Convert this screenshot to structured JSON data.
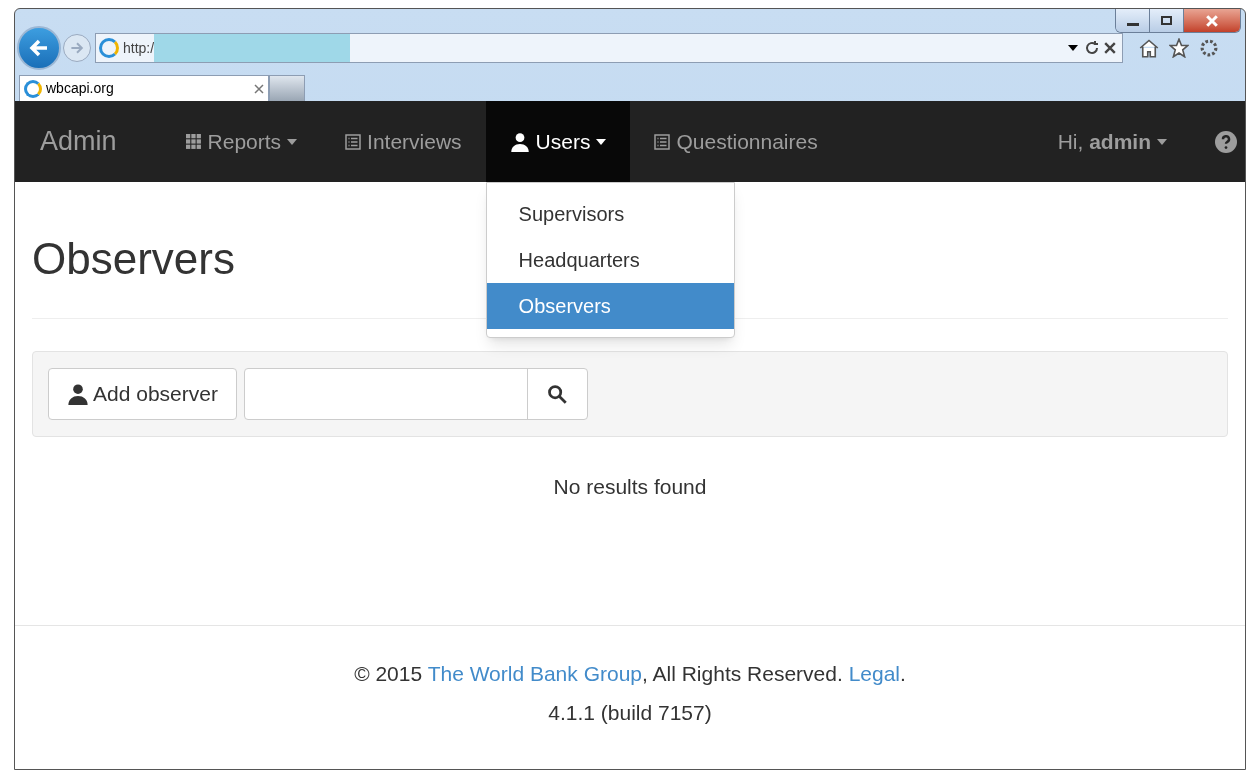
{
  "browser": {
    "address": "http:/",
    "tab_title": "wbcapi.org"
  },
  "navbar": {
    "brand": "Admin",
    "items": [
      {
        "label": "Reports",
        "kind": "grid",
        "dropdown": true,
        "selected": false
      },
      {
        "label": "Interviews",
        "kind": "list",
        "dropdown": false,
        "selected": false
      },
      {
        "label": "Users",
        "kind": "user",
        "dropdown": true,
        "selected": true
      },
      {
        "label": "Questionnaires",
        "kind": "list",
        "dropdown": false,
        "selected": false
      }
    ],
    "greeting": "Hi,",
    "user": "admin"
  },
  "dropdown": [
    {
      "label": "Supervisors",
      "selected": false
    },
    {
      "label": "Headquarters",
      "selected": false
    },
    {
      "label": "Observers",
      "selected": true
    }
  ],
  "page": {
    "title": "Observers",
    "add_button": "Add observer",
    "empty_message": "No results found"
  },
  "footer": {
    "parts": [
      {
        "kind": "text",
        "text": "© 2015"
      },
      {
        "kind": "link",
        "text": "The World Bank Group"
      },
      {
        "kind": "text",
        "text": ", All Rights Reserved."
      },
      {
        "kind": "link",
        "text": "Legal"
      },
      {
        "kind": "text",
        "text": "."
      }
    ],
    "version": "4.1.1 (build 7157)"
  }
}
